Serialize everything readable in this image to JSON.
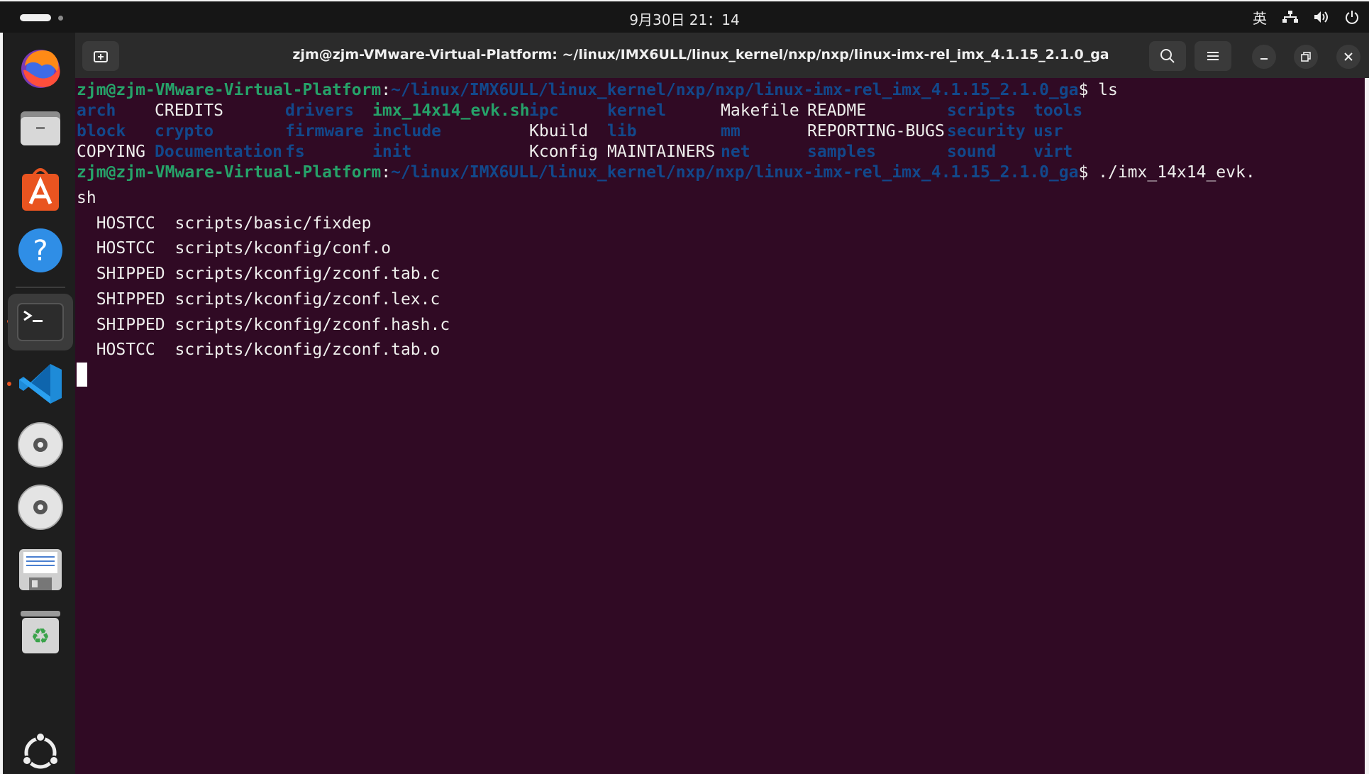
{
  "topbar": {
    "clock": "9月30日  21：14",
    "input_method": "英",
    "icons": [
      "network-icon",
      "volume-icon",
      "power-icon"
    ]
  },
  "dock": {
    "apps": [
      "firefox-icon",
      "files-icon",
      "app-center-icon",
      "help-icon",
      "terminal-icon",
      "vscode-icon",
      "disc-icon",
      "disc-icon",
      "save-icon",
      "trash-icon",
      "show-apps-icon"
    ],
    "accent": "#e95420"
  },
  "window": {
    "title": "zjm@zjm-VMware-Virtual-Platform: ~/linux/IMX6ULL/linux_kernel/nxp/nxp/linux-imx-rel_imx_4.1.15_2.1.0_ga",
    "background": "#300a24"
  },
  "terminal": {
    "prompt_user": "zjm@zjm-VMware-Virtual-Platform",
    "prompt_path": "~/linux/IMX6ULL/linux_kernel/nxp/nxp/linux-imx-rel_imx_4.1.15_2.1.0_ga",
    "cmd1": "ls",
    "ls_rows": [
      [
        {
          "name": "arch",
          "kind": "dir"
        },
        {
          "name": "CREDITS",
          "kind": "file"
        },
        {
          "name": "drivers",
          "kind": "dir"
        },
        {
          "name": "imx_14x14_evk.sh",
          "kind": "exe"
        },
        {
          "name": "ipc",
          "kind": "dir"
        },
        {
          "name": "kernel",
          "kind": "dir"
        },
        {
          "name": "Makefile",
          "kind": "file"
        },
        {
          "name": "README",
          "kind": "file"
        },
        {
          "name": "scripts",
          "kind": "dir"
        },
        {
          "name": "tools",
          "kind": "dir"
        }
      ],
      [
        {
          "name": "block",
          "kind": "dir"
        },
        {
          "name": "crypto",
          "kind": "dir"
        },
        {
          "name": "firmware",
          "kind": "dir"
        },
        {
          "name": "include",
          "kind": "dir"
        },
        {
          "name": "Kbuild",
          "kind": "file"
        },
        {
          "name": "lib",
          "kind": "dir"
        },
        {
          "name": "mm",
          "kind": "dir"
        },
        {
          "name": "REPORTING-BUGS",
          "kind": "file"
        },
        {
          "name": "security",
          "kind": "dir"
        },
        {
          "name": "usr",
          "kind": "dir"
        }
      ],
      [
        {
          "name": "COPYING",
          "kind": "file"
        },
        {
          "name": "Documentation",
          "kind": "dir"
        },
        {
          "name": "fs",
          "kind": "dir"
        },
        {
          "name": "init",
          "kind": "dir"
        },
        {
          "name": "Kconfig",
          "kind": "file"
        },
        {
          "name": "MAINTAINERS",
          "kind": "file"
        },
        {
          "name": "net",
          "kind": "dir"
        },
        {
          "name": "samples",
          "kind": "dir"
        },
        {
          "name": "sound",
          "kind": "dir"
        },
        {
          "name": "virt",
          "kind": "dir"
        }
      ]
    ],
    "cmd2": "./imx_14x14_evk.",
    "cmd2_wrap": "sh",
    "build_lines": [
      "  HOSTCC  scripts/basic/fixdep",
      "  HOSTCC  scripts/kconfig/conf.o",
      "  SHIPPED scripts/kconfig/zconf.tab.c",
      "  SHIPPED scripts/kconfig/zconf.lex.c",
      "  SHIPPED scripts/kconfig/zconf.hash.c",
      "  HOSTCC  scripts/kconfig/zconf.tab.o"
    ],
    "colors": {
      "user": "#26a269",
      "path": "#12488b",
      "text": "#eeeeec"
    }
  }
}
